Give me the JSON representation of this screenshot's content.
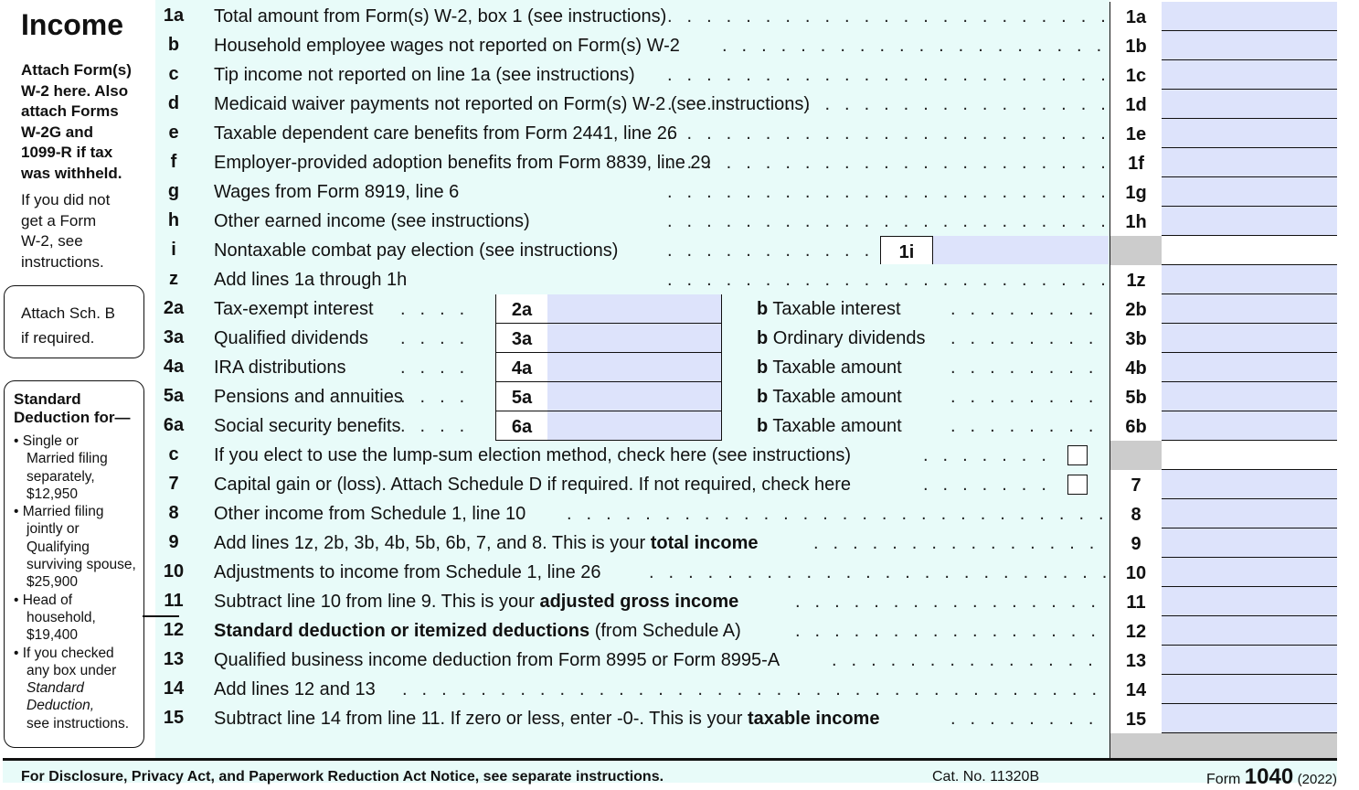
{
  "section": {
    "title": "Income",
    "attach_bold": [
      "Attach Form(s)",
      "W-2 here. Also",
      "attach Forms",
      "W-2G and",
      "1099-R if tax",
      "was withheld."
    ],
    "no_w2": [
      "If you did not",
      "get a Form",
      "W-2, see",
      "instructions."
    ],
    "sch_b": [
      "Attach Sch. B",
      "if required."
    ],
    "std_title": [
      "Standard",
      "Deduction for—"
    ],
    "std_items": [
      {
        "bullet": "• Single or",
        "lines": [
          "Married filing",
          "separately,",
          "$12,950"
        ]
      },
      {
        "bullet": "• Married filing",
        "lines": [
          "jointly or",
          "Qualifying",
          "surviving spouse,",
          "$25,900"
        ]
      },
      {
        "bullet": "• Head of",
        "lines": [
          "household,",
          "$19,400"
        ]
      },
      {
        "bullet": "• If you checked",
        "lines": [
          "any box under",
          "Standard",
          "Deduction,",
          "see instructions."
        ]
      }
    ]
  },
  "lines": [
    {
      "num": "1a",
      "desc": "Total amount from Form(s) W-2, box 1 (see instructions)",
      "box": "1a"
    },
    {
      "num": "b",
      "desc": "Household employee wages not reported on Form(s) W-2",
      "box": "1b"
    },
    {
      "num": "c",
      "desc": "Tip income not reported on line 1a (see instructions)",
      "box": "1c"
    },
    {
      "num": "d",
      "desc": "Medicaid waiver payments not reported on Form(s) W-2 (see instructions)",
      "box": "1d"
    },
    {
      "num": "e",
      "desc": "Taxable dependent care benefits from Form 2441, line 26",
      "box": "1e"
    },
    {
      "num": "f",
      "desc": "Employer-provided adoption benefits from Form 8839, line 29",
      "box": "1f"
    },
    {
      "num": "g",
      "desc": "Wages from Form 8919, line 6",
      "box": "1g"
    },
    {
      "num": "h",
      "desc": "Other earned income (see instructions)",
      "box": "1h"
    },
    {
      "num": "i",
      "desc": "Nontaxable combat pay election (see instructions)",
      "box": "",
      "inline_box": "1i"
    },
    {
      "num": "z",
      "desc": "Add lines 1a through 1h",
      "box": "1z"
    }
  ],
  "paired": [
    {
      "num": "2a",
      "desc": "Tax-exempt interest",
      "abox": "2a",
      "b": "b",
      "bdesc": "Taxable interest",
      "box": "2b"
    },
    {
      "num": "3a",
      "desc": "Qualified dividends",
      "abox": "3a",
      "b": "b",
      "bdesc": "Ordinary dividends",
      "box": "3b"
    },
    {
      "num": "4a",
      "desc": "IRA distributions",
      "abox": "4a",
      "b": "b",
      "bdesc": "Taxable amount",
      "box": "4b"
    },
    {
      "num": "5a",
      "desc": "Pensions and annuities",
      "abox": "5a",
      "b": "b",
      "bdesc": "Taxable amount",
      "box": "5b"
    },
    {
      "num": "6a",
      "desc": "Social security benefits",
      "abox": "6a",
      "b": "b",
      "bdesc": "Taxable amount",
      "box": "6b"
    }
  ],
  "line6c": {
    "num": "c",
    "desc": "If you elect to use the lump-sum election method, check here (see instructions)"
  },
  "line7": {
    "num": "7",
    "desc": "Capital gain or (loss). Attach Schedule D if required. If not required, check here",
    "box": "7"
  },
  "line8": {
    "num": "8",
    "desc": "Other income from Schedule 1, line 10",
    "box": "8"
  },
  "line9": {
    "num": "9",
    "desc_pre": "Add lines 1z, 2b, 3b, 4b, 5b, 6b, 7, and 8. This is your ",
    "desc_bold": "total income",
    "box": "9"
  },
  "line10": {
    "num": "10",
    "desc": "Adjustments to income from Schedule 1, line 26",
    "box": "10"
  },
  "line11": {
    "num": "11",
    "desc_pre": "Subtract line 10 from line 9. This is your ",
    "desc_bold": "adjusted gross income",
    "box": "11"
  },
  "line12": {
    "num": "12",
    "desc_bold": "Standard deduction or itemized deductions",
    "desc_post": " (from Schedule A)",
    "box": "12"
  },
  "line13": {
    "num": "13",
    "desc": "Qualified business income deduction from Form 8995 or Form 8995-A",
    "box": "13"
  },
  "line14": {
    "num": "14",
    "desc": "Add lines 12 and 13",
    "box": "14"
  },
  "line15": {
    "num": "15",
    "desc_pre": "Subtract line 14 from line 11. If zero or less, enter -0-. This is your ",
    "desc_bold": "taxable income",
    "box": "15"
  },
  "footer": {
    "notice": "For Disclosure, Privacy Act, and Paperwork Reduction Act Notice, see separate instructions.",
    "cat": "Cat. No. 11320B",
    "form_pre": "Form ",
    "form_num": "1040",
    "form_year": "(2022)"
  },
  "colors": {
    "panel": "#e8fbf9",
    "entry": "#dde3fb",
    "shaded": "#cccccc"
  }
}
